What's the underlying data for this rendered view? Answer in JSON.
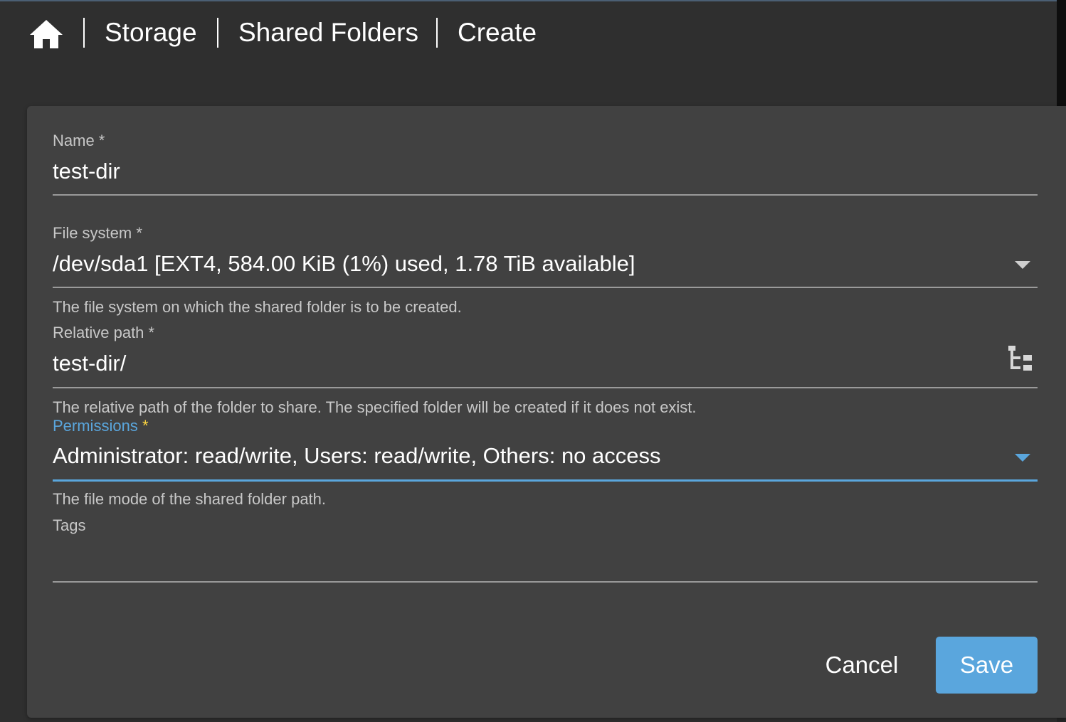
{
  "breadcrumb": {
    "home_icon": "home-icon",
    "items": [
      "Storage",
      "Shared Folders",
      "Create"
    ]
  },
  "form": {
    "name": {
      "label": "Name *",
      "value": "test-dir"
    },
    "file_system": {
      "label": "File system *",
      "value": "/dev/sda1 [EXT4, 584.00 KiB (1%) used, 1.78 TiB available]",
      "hint": "The file system on which the shared folder is to be created.",
      "icon": "chevron-down-icon"
    },
    "relative_path": {
      "label": "Relative path *",
      "value": "test-dir/",
      "hint": "The relative path of the folder to share. The specified folder will be created if it does not exist.",
      "icon": "folder-tree-icon"
    },
    "permissions": {
      "label": "Permissions",
      "required_mark": "*",
      "value": "Administrator: read/write, Users: read/write, Others: no access",
      "hint": "The file mode of the shared folder path.",
      "icon": "chevron-down-icon"
    },
    "tags": {
      "label": "Tags",
      "value": ""
    }
  },
  "buttons": {
    "cancel": "Cancel",
    "save": "Save"
  },
  "colors": {
    "accent": "#5aa6dd",
    "background": "#2f2f2f",
    "card": "#414141",
    "required_star": "#ffd740"
  }
}
